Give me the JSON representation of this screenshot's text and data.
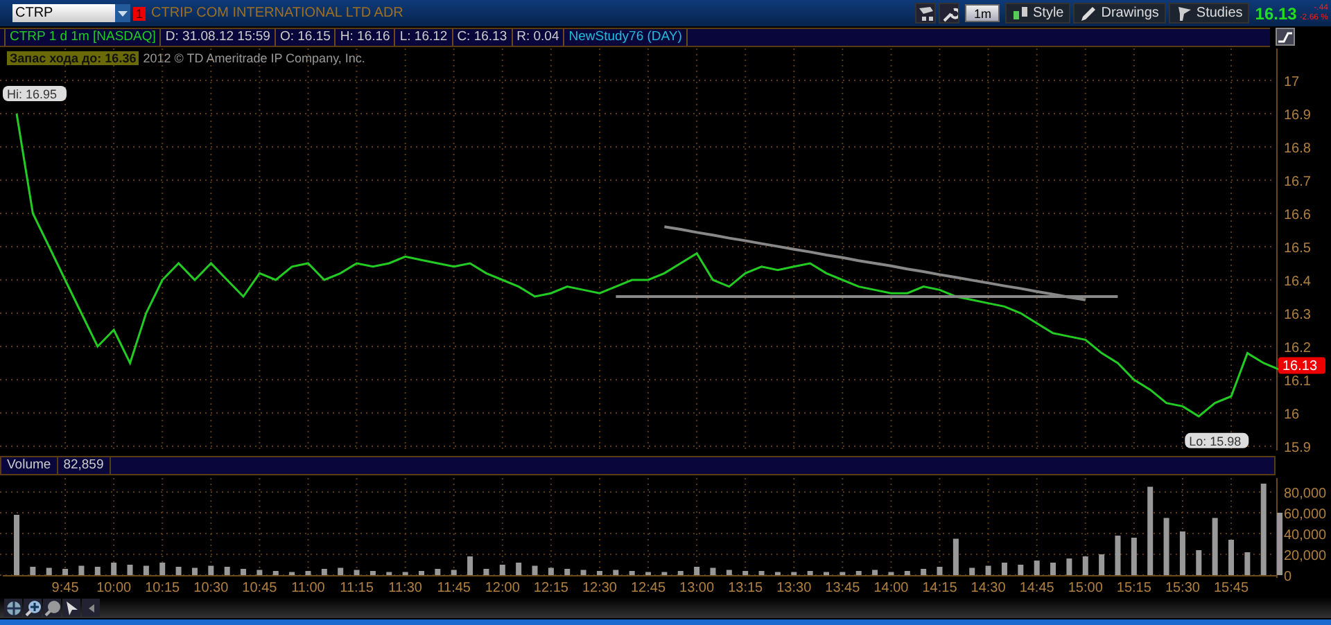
{
  "toolbar": {
    "symbol": "CTRP",
    "alert_badge": "1",
    "company": "CTRIP COM INTERNATIONAL LTD ADR",
    "interval": "1m",
    "buttons": [
      {
        "kind": "style",
        "label": "Style"
      },
      {
        "kind": "drawings",
        "label": "Drawings"
      },
      {
        "kind": "studies",
        "label": "Studies"
      }
    ],
    "last_price": "16.13",
    "change": "-.44",
    "change_percent": "-2.66 %"
  },
  "info_bar": {
    "title": "CTRP 1 d 1m [NASDAQ]",
    "fields": [
      "D: 31.08.12 15:59",
      "O: 16.15",
      "H: 16.16",
      "L: 16.12",
      "C: 16.13",
      "R: 0.04"
    ],
    "study": "NewStudy76 (DAY)"
  },
  "range_badge": "Запас хода до: 16.36",
  "copyright": "2012 © TD Ameritrade IP Company, Inc.",
  "price_chart": {
    "price_tag": "16.13",
    "chart_data": {
      "type": "line",
      "grid": true,
      "series": [
        {
          "color": "#22cc22",
          "values": [
            16.9,
            16.6,
            16.5,
            16.4,
            16.3,
            16.2,
            16.25,
            16.15,
            16.3,
            16.4,
            16.45,
            16.4,
            16.45,
            16.4,
            16.35,
            16.42,
            16.4,
            16.44,
            16.45,
            16.4,
            16.42,
            16.45,
            16.44,
            16.45,
            16.47,
            16.46,
            16.45,
            16.44,
            16.45,
            16.42,
            16.4,
            16.38,
            16.35,
            16.36,
            16.38,
            16.37,
            16.36,
            16.38,
            16.4,
            16.4,
            16.42,
            16.45,
            16.48,
            16.4,
            16.38,
            16.42,
            16.44,
            16.43,
            16.44,
            16.45,
            16.42,
            16.4,
            16.38,
            16.37,
            16.36,
            16.36,
            16.38,
            16.37,
            16.35,
            16.34,
            16.33,
            16.32,
            16.3,
            16.27,
            16.24,
            16.23,
            16.22,
            16.18,
            16.15,
            16.1,
            16.07,
            16.03,
            16.02,
            15.99,
            16.03,
            16.05,
            16.18,
            16.15,
            16.13
          ]
        },
        {
          "color": "#888888",
          "values": [
            null,
            null,
            null,
            null,
            null,
            null,
            null,
            null,
            null,
            null,
            null,
            null,
            null,
            null,
            null,
            null,
            null,
            null,
            null,
            null,
            null,
            null,
            null,
            null,
            null,
            null,
            null,
            null,
            null,
            null,
            null,
            null,
            null,
            null,
            null,
            null,
            null,
            null,
            null,
            null,
            16.56,
            16.552,
            16.543,
            16.535,
            16.526,
            16.518,
            16.509,
            16.501,
            16.492,
            16.484,
            16.475,
            16.467,
            16.458,
            16.45,
            16.442,
            16.433,
            16.425,
            16.416,
            16.408,
            16.399,
            16.391,
            16.382,
            16.374,
            16.365,
            16.357,
            16.348,
            16.34,
            null,
            null,
            null,
            null,
            null,
            null,
            null,
            null,
            null,
            null,
            null,
            null
          ]
        },
        {
          "color": "#888888",
          "values": [
            null,
            null,
            null,
            null,
            null,
            null,
            null,
            null,
            null,
            null,
            null,
            null,
            null,
            null,
            null,
            null,
            null,
            null,
            null,
            null,
            null,
            null,
            null,
            null,
            null,
            null,
            null,
            null,
            null,
            null,
            null,
            null,
            null,
            null,
            null,
            null,
            null,
            16.35,
            16.35,
            16.35,
            16.35,
            16.35,
            16.35,
            16.35,
            16.35,
            16.35,
            16.35,
            16.35,
            16.35,
            16.35,
            16.35,
            16.35,
            16.35,
            16.35,
            16.35,
            16.35,
            16.35,
            16.35,
            16.35,
            16.35,
            16.35,
            16.35,
            16.35,
            16.35,
            16.35,
            16.35,
            16.35,
            16.35,
            16.35,
            null,
            null,
            null,
            null,
            null,
            null,
            null,
            null,
            null,
            null,
            null,
            null
          ]
        }
      ],
      "ylim": [
        15.9,
        17
      ],
      "yticks": [
        {
          "value": 17,
          "label": "17"
        },
        {
          "value": 16.9,
          "label": "16.9"
        },
        {
          "value": 16.8,
          "label": "16.8"
        },
        {
          "value": 16.7,
          "label": "16.7"
        },
        {
          "value": 16.6,
          "label": "16.6"
        },
        {
          "value": 16.5,
          "label": "16.5"
        },
        {
          "value": 16.4,
          "label": "16.4"
        },
        {
          "value": 16.3,
          "label": "16.3"
        },
        {
          "value": 16.2,
          "label": "16.2"
        },
        {
          "value": 16.1,
          "label": "16.1"
        },
        {
          "value": 16,
          "label": "16"
        },
        {
          "value": 15.9,
          "label": "15.9"
        }
      ],
      "annotations": [
        "Hi: 16.95",
        "Lo: 15.98"
      ]
    }
  },
  "volume_pane": {
    "label": "Volume",
    "value": "82,859",
    "chart_data": {
      "type": "bar",
      "grid": true,
      "categories": [
        null,
        null,
        null,
        "9:45",
        null,
        null,
        "10:00",
        null,
        null,
        "10:15",
        null,
        null,
        "10:30",
        null,
        null,
        "10:45",
        null,
        null,
        "11:00",
        null,
        null,
        "11:15",
        null,
        null,
        "11:30",
        null,
        null,
        "11:45",
        null,
        null,
        "12:00",
        null,
        null,
        "12:15",
        null,
        null,
        "12:30",
        null,
        null,
        "12:45",
        null,
        null,
        "13:00",
        null,
        null,
        "13:15",
        null,
        null,
        "13:30",
        null,
        null,
        "13:45",
        null,
        null,
        "14:00",
        null,
        null,
        "14:15",
        null,
        null,
        "14:30",
        null,
        null,
        "14:45",
        null,
        null,
        "15:00",
        null,
        null,
        "15:15",
        null,
        null,
        "15:30",
        null,
        null,
        "15:45",
        null,
        null,
        null
      ],
      "values": [
        58000,
        8000,
        7000,
        6000,
        9000,
        8000,
        12000,
        10000,
        9000,
        12000,
        8000,
        7000,
        9000,
        8000,
        6000,
        5000,
        4000,
        3000,
        4000,
        6000,
        7000,
        5000,
        4000,
        3000,
        3000,
        4000,
        6000,
        5000,
        18000,
        6000,
        10000,
        12000,
        9000,
        7000,
        6000,
        5000,
        4000,
        5000,
        4000,
        3000,
        3000,
        4000,
        8000,
        7000,
        5000,
        4000,
        4000,
        3000,
        3000,
        4000,
        3000,
        3000,
        4000,
        5000,
        3000,
        4000,
        6000,
        8000,
        35000,
        7000,
        9000,
        12000,
        10000,
        14000,
        12000,
        16000,
        18000,
        20000,
        38000,
        36000,
        85000,
        55000,
        42000,
        24000,
        55000,
        34000,
        22000,
        88000,
        60000
      ],
      "ylim": [
        0,
        90000
      ],
      "yticks": [
        {
          "value": 0,
          "label": "0"
        },
        {
          "value": 20000,
          "label": "20,000"
        },
        {
          "value": 40000,
          "label": "40,000"
        },
        {
          "value": 60000,
          "label": "60,000"
        },
        {
          "value": 80000,
          "label": "80,000"
        }
      ]
    }
  }
}
